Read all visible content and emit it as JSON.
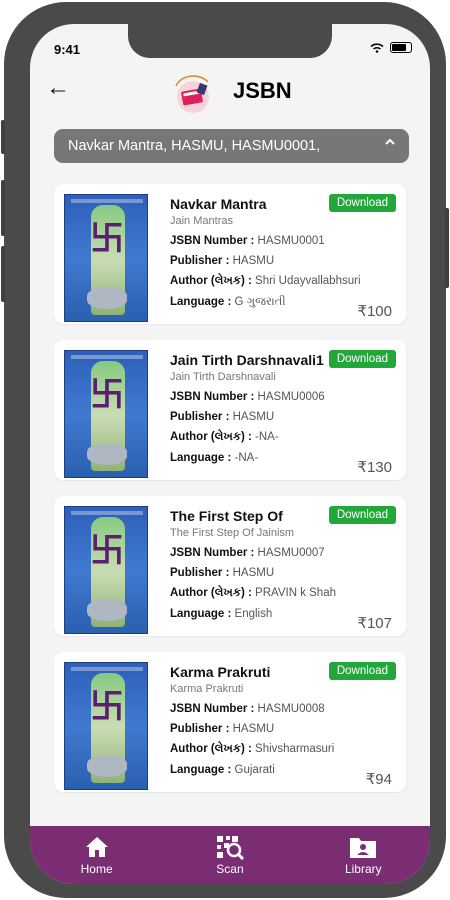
{
  "status": {
    "time": "9:41"
  },
  "header": {
    "title": "JSBN"
  },
  "search": {
    "value": "Navkar Mantra, HASMU, HASMU0001,"
  },
  "labels": {
    "jsbn": "JSBN Number : ",
    "publisher": "Publisher : ",
    "author": "Author (લેખક) : ",
    "language": "Language : ",
    "download": "Download"
  },
  "books": [
    {
      "title": "Navkar Mantra",
      "subtitle": "Jain Mantras",
      "jsbn": "HASMU0001",
      "publisher": "HASMU",
      "author": "Shri Udayvallabhsuri",
      "language": "G ગુજરાતી",
      "price": "₹100"
    },
    {
      "title": "Jain Tirth Darshnavali1",
      "subtitle": "Jain Tirth Darshnavali",
      "jsbn": "HASMU0006",
      "publisher": "HASMU",
      "author": "-NA-",
      "language": " -NA-",
      "price": "₹130"
    },
    {
      "title": "The First Step Of",
      "subtitle": "The First Step Of Jainism",
      "jsbn": "HASMU0007",
      "publisher": "HASMU",
      "author": "PRAVIN k Shah",
      "language": "English",
      "price": "₹107"
    },
    {
      "title": "Karma Prakruti",
      "subtitle": "Karma Prakruti",
      "jsbn": "HASMU0008",
      "publisher": "HASMU",
      "author": "Shivsharmasuri",
      "language": "Gujarati",
      "price": "₹94"
    }
  ],
  "nav": [
    {
      "label": "Home",
      "icon": "home-icon"
    },
    {
      "label": "Scan",
      "icon": "scan-icon"
    },
    {
      "label": "Library",
      "icon": "library-icon"
    }
  ],
  "colors": {
    "nav_bg": "#7b2d73",
    "download_bg": "#22a83a",
    "search_bg": "#777777"
  }
}
